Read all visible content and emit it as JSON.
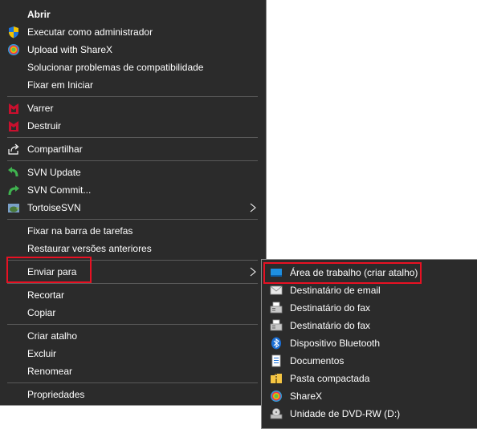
{
  "context_menu": {
    "items": [
      {
        "label": "Abrir"
      },
      {
        "label": "Executar como administrador",
        "icon": "uac-shield-icon"
      },
      {
        "label": "Upload with ShareX",
        "icon": "sharex-icon"
      },
      {
        "label": "Solucionar problemas de compatibilidade"
      },
      {
        "label": "Fixar em Iniciar"
      },
      {
        "label": "Varrer",
        "icon": "mcafee-icon"
      },
      {
        "label": "Destruir",
        "icon": "mcafee-icon"
      },
      {
        "label": "Compartilhar",
        "icon": "share-icon"
      },
      {
        "label": "SVN Update",
        "icon": "svn-update-icon"
      },
      {
        "label": "SVN Commit...",
        "icon": "svn-commit-icon"
      },
      {
        "label": "TortoiseSVN",
        "icon": "tortoisesvn-icon"
      },
      {
        "label": "Fixar na barra de tarefas"
      },
      {
        "label": "Restaurar versões anteriores"
      },
      {
        "label": "Enviar para"
      },
      {
        "label": "Recortar"
      },
      {
        "label": "Copiar"
      },
      {
        "label": "Criar atalho"
      },
      {
        "label": "Excluir"
      },
      {
        "label": "Renomear"
      },
      {
        "label": "Propriedades"
      }
    ]
  },
  "send_to_menu": {
    "items": [
      {
        "label": "Área de trabalho (criar atalho)",
        "icon": "desktop-icon"
      },
      {
        "label": "Destinatário de email",
        "icon": "mail-icon"
      },
      {
        "label": "Destinatário do fax",
        "icon": "fax-icon"
      },
      {
        "label": "Destinatário do fax",
        "icon": "fax-icon"
      },
      {
        "label": "Dispositivo Bluetooth",
        "icon": "bluetooth-icon"
      },
      {
        "label": "Documentos",
        "icon": "documents-icon"
      },
      {
        "label": "Pasta compactada",
        "icon": "zip-folder-icon"
      },
      {
        "label": "ShareX",
        "icon": "sharex-icon"
      },
      {
        "label": "Unidade de DVD-RW (D:)",
        "icon": "dvd-drive-icon"
      }
    ]
  },
  "colors": {
    "menu_bg": "#2b2b2b",
    "highlight": "#e81123",
    "text": "#ffffff"
  }
}
